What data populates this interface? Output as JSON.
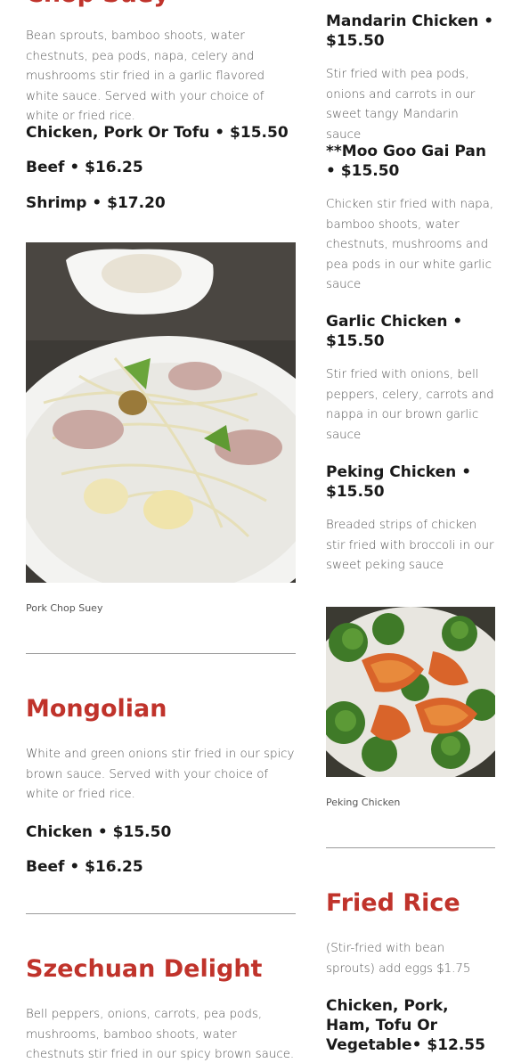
{
  "colors": {
    "accent": "#c0332b",
    "text": "#1a1a1a",
    "muted": "#555555"
  },
  "left": {
    "chop_suey": {
      "title": "Chop Suey",
      "description": "Bean sprouts, bamboo shoots, water chestnuts, pea pods, napa, celery and mushrooms stir fried in a garlic flavored white sauce. Served with your choice of white or fried rice.",
      "items": [
        "Chicken, Pork Or Tofu • $15.50",
        "Beef • $16.25",
        "Shrimp • $17.20"
      ],
      "photo_caption": "Pork Chop Suey"
    },
    "mongolian": {
      "title": "Mongolian",
      "description": "White and green onions stir fried in our spicy brown sauce. Served with your choice of white or fried rice.",
      "items": [
        "Chicken • $15.50",
        "Beef • $16.25"
      ]
    },
    "szechuan": {
      "title": "Szechuan Delight",
      "description": "Bell peppers, onions, carrots, pea pods, mushrooms, bamboo shoots, water chestnuts stir fried in our spicy brown sauce. Served with"
    }
  },
  "right": {
    "items": [
      {
        "name": "Mandarin Chicken • $15.50",
        "description": "Stir fried with pea pods, onions and carrots in our sweet tangy Mandarin sauce"
      },
      {
        "name": "**Moo Goo Gai Pan • $15.50",
        "description": "Chicken stir fried with napa, bamboo shoots, water chestnuts, mushrooms and pea pods in our white garlic sauce"
      },
      {
        "name": "Garlic Chicken • $15.50",
        "description": "Stir fried with onions, bell peppers, celery, carrots and nappa in our brown garlic sauce"
      },
      {
        "name": "Peking Chicken • $15.50",
        "description": "Breaded strips of chicken stir fried with broccoli in our sweet peking sauce"
      }
    ],
    "photo_caption": "Peking Chicken",
    "fried_rice": {
      "title": "Fried Rice",
      "description": "(Stir-fried with bean sprouts) add eggs $1.75",
      "items": [
        "Chicken, Pork, Ham, Tofu Or Vegetable• $12.55"
      ]
    }
  }
}
